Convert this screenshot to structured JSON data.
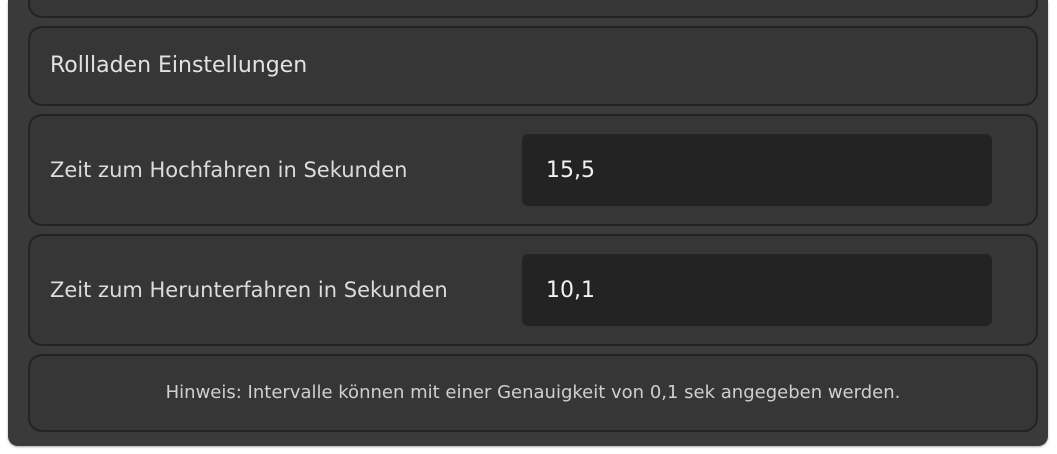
{
  "section": {
    "title": "Rollladen Einstellungen"
  },
  "fields": [
    {
      "label": "Zeit zum Hochfahren in Sekunden",
      "value": "15,5"
    },
    {
      "label": "Zeit zum Herunterfahren in Sekunden",
      "value": "10,1"
    }
  ],
  "note": {
    "text": "Hinweis: Intervalle können mit einer Genauigkeit von 0,1 sek angegeben werden."
  }
}
